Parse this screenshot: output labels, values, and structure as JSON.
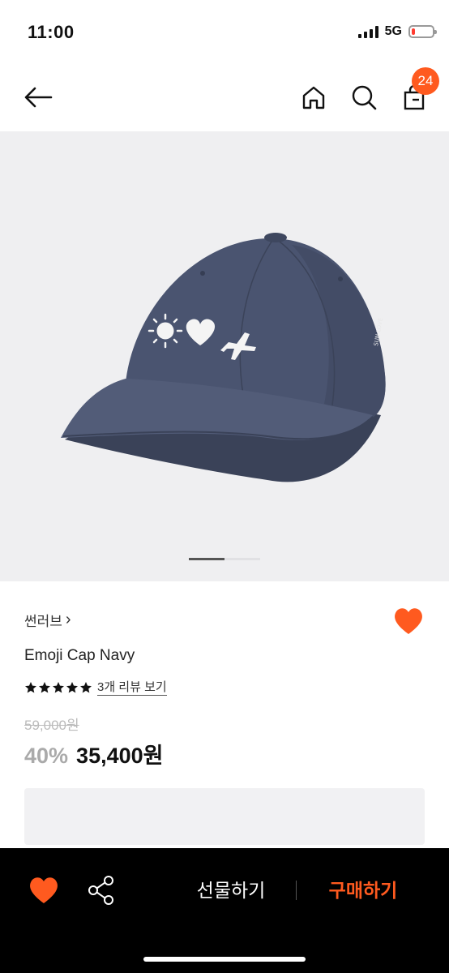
{
  "status_bar": {
    "time": "11:00",
    "network": "5G",
    "battery_level": 0.15
  },
  "nav": {
    "back_icon": "arrow-left-icon",
    "home_icon": "home-icon",
    "search_icon": "search-icon",
    "cart_icon": "shopping-bag-icon",
    "cart_count": "24"
  },
  "product": {
    "brand": "썬러브",
    "brand_chevron": "›",
    "name": "Emoji Cap Navy",
    "rating": 5,
    "review_link": "3개 리뷰 보기",
    "original_price": "59,000원",
    "discount": "40%",
    "sale_price": "35,400원",
    "image_subject": "navy baseball cap with sun, heart and airplane embroidery"
  },
  "gallery": {
    "current_page": 1,
    "total_pages": 2
  },
  "bottom_bar": {
    "gift_label": "선물하기",
    "buy_label": "구매하기"
  },
  "colors": {
    "accent": "#ff5a1f",
    "cap_navy": "#4a5470",
    "image_bg": "#efeff1"
  }
}
